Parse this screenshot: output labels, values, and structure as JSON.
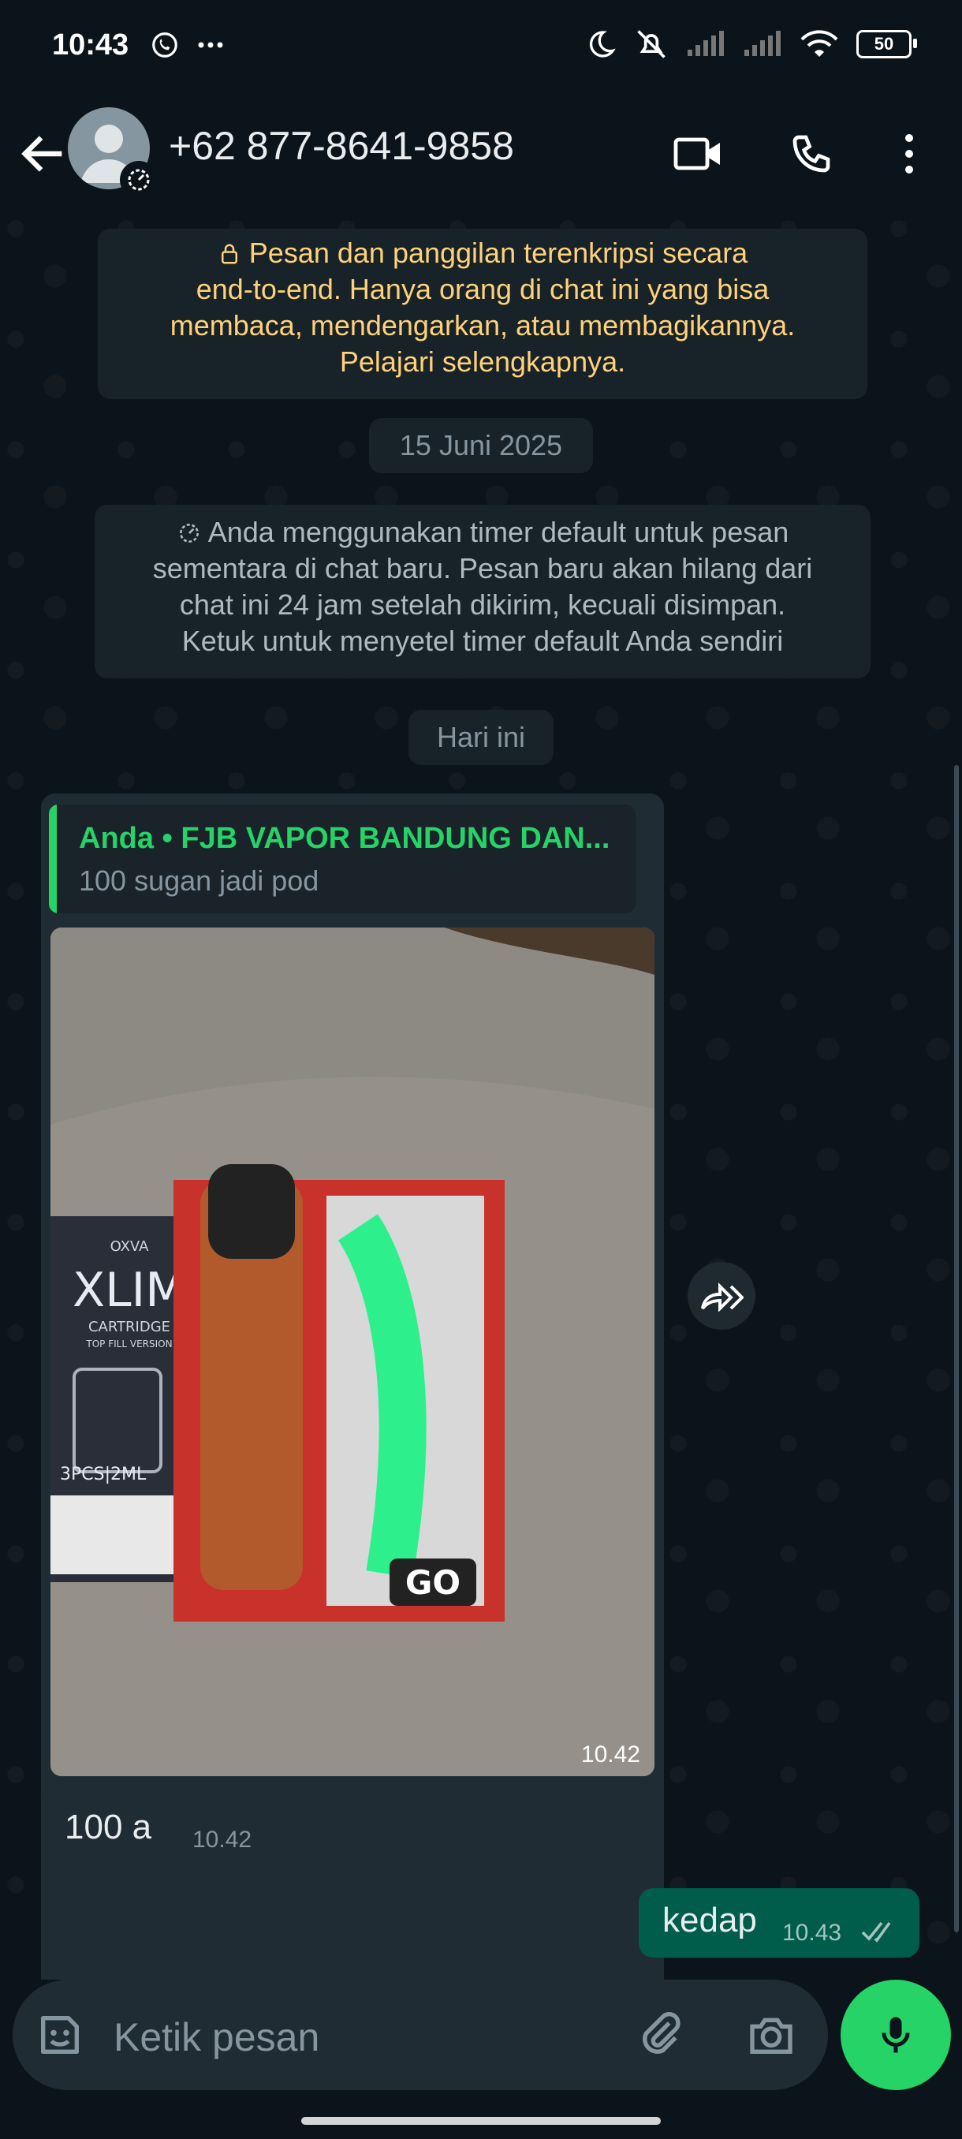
{
  "status_bar": {
    "time": "10:43",
    "battery": "50",
    "icons": [
      "whatsapp-icon",
      "more-dots-icon",
      "moon-icon",
      "mute-icon",
      "signal-icon",
      "signal-icon",
      "wifi-icon",
      "battery-icon"
    ]
  },
  "header": {
    "contact": "+62 877-8641-9858",
    "icons": [
      "back-arrow-icon",
      "avatar",
      "disappearing-timer-icon",
      "video-call-icon",
      "voice-call-icon",
      "more-vert-icon"
    ]
  },
  "encryption_notice": {
    "line1": "Pesan dan panggilan terenkripsi secara",
    "line2": "end-to-end. Hanya orang di chat ini yang bisa",
    "line3": "membaca, mendengarkan, atau membagikannya.",
    "line4": "Pelajari selengkapnya."
  },
  "date_chip_1": "15 Juni 2025",
  "timer_notice": {
    "line1": "Anda menggunakan timer default untuk pesan",
    "line2": "sementara di chat baru. Pesan baru akan hilang dari",
    "line3": "chat ini 24 jam setelah dikirim, kecuali disimpan.",
    "line4": "Ketuk untuk menyetel timer default Anda sendiri"
  },
  "date_chip_2": "Hari ini",
  "messages": [
    {
      "direction": "incoming",
      "reply_title": "Anda • FJB VAPOR BANDUNG DAN...",
      "reply_text": "100 sugan jadi pod",
      "photo_box_text_1": "OXVA",
      "photo_box_text_2": "XLIM",
      "photo_box_text_3": "CARTRIDGE",
      "photo_box_text_4": "TOP FILL VERSION",
      "photo_box_text_5": "3PCS|2ML",
      "photo_box_text_6": "GO",
      "time": "10.42"
    },
    {
      "direction": "incoming",
      "text": "100 a",
      "time": "10.42"
    },
    {
      "direction": "outgoing",
      "text": "kedap",
      "time": "10.43",
      "status": "read"
    }
  ],
  "composer": {
    "placeholder": "Ketik pesan",
    "icons": [
      "sticker-icon",
      "attach-icon",
      "camera-icon",
      "mic-icon"
    ]
  },
  "colors": {
    "background": "#0b141a",
    "incoming_bubble": "#202c33",
    "outgoing_bubble": "#005c4b",
    "accent": "#25d366",
    "system_text": "#ffd279"
  }
}
